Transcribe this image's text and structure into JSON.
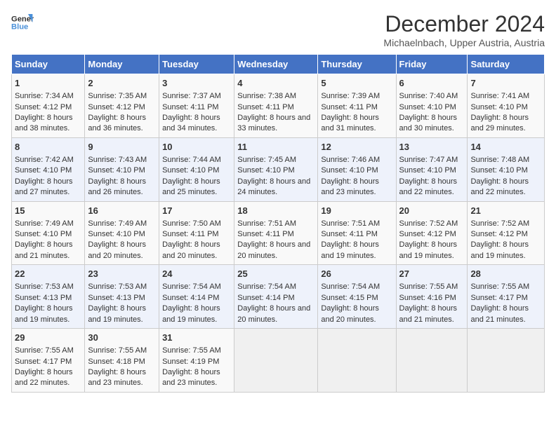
{
  "logo": {
    "line1": "General",
    "line2": "Blue"
  },
  "title": "December 2024",
  "subtitle": "Michaelnbach, Upper Austria, Austria",
  "days_of_week": [
    "Sunday",
    "Monday",
    "Tuesday",
    "Wednesday",
    "Thursday",
    "Friday",
    "Saturday"
  ],
  "weeks": [
    [
      {
        "day": "1",
        "sunrise": "7:34 AM",
        "sunset": "4:12 PM",
        "daylight": "8 hours and 38 minutes."
      },
      {
        "day": "2",
        "sunrise": "7:35 AM",
        "sunset": "4:12 PM",
        "daylight": "8 hours and 36 minutes."
      },
      {
        "day": "3",
        "sunrise": "7:37 AM",
        "sunset": "4:11 PM",
        "daylight": "8 hours and 34 minutes."
      },
      {
        "day": "4",
        "sunrise": "7:38 AM",
        "sunset": "4:11 PM",
        "daylight": "8 hours and 33 minutes."
      },
      {
        "day": "5",
        "sunrise": "7:39 AM",
        "sunset": "4:11 PM",
        "daylight": "8 hours and 31 minutes."
      },
      {
        "day": "6",
        "sunrise": "7:40 AM",
        "sunset": "4:10 PM",
        "daylight": "8 hours and 30 minutes."
      },
      {
        "day": "7",
        "sunrise": "7:41 AM",
        "sunset": "4:10 PM",
        "daylight": "8 hours and 29 minutes."
      }
    ],
    [
      {
        "day": "8",
        "sunrise": "7:42 AM",
        "sunset": "4:10 PM",
        "daylight": "8 hours and 27 minutes."
      },
      {
        "day": "9",
        "sunrise": "7:43 AM",
        "sunset": "4:10 PM",
        "daylight": "8 hours and 26 minutes."
      },
      {
        "day": "10",
        "sunrise": "7:44 AM",
        "sunset": "4:10 PM",
        "daylight": "8 hours and 25 minutes."
      },
      {
        "day": "11",
        "sunrise": "7:45 AM",
        "sunset": "4:10 PM",
        "daylight": "8 hours and 24 minutes."
      },
      {
        "day": "12",
        "sunrise": "7:46 AM",
        "sunset": "4:10 PM",
        "daylight": "8 hours and 23 minutes."
      },
      {
        "day": "13",
        "sunrise": "7:47 AM",
        "sunset": "4:10 PM",
        "daylight": "8 hours and 22 minutes."
      },
      {
        "day": "14",
        "sunrise": "7:48 AM",
        "sunset": "4:10 PM",
        "daylight": "8 hours and 22 minutes."
      }
    ],
    [
      {
        "day": "15",
        "sunrise": "7:49 AM",
        "sunset": "4:10 PM",
        "daylight": "8 hours and 21 minutes."
      },
      {
        "day": "16",
        "sunrise": "7:49 AM",
        "sunset": "4:10 PM",
        "daylight": "8 hours and 20 minutes."
      },
      {
        "day": "17",
        "sunrise": "7:50 AM",
        "sunset": "4:11 PM",
        "daylight": "8 hours and 20 minutes."
      },
      {
        "day": "18",
        "sunrise": "7:51 AM",
        "sunset": "4:11 PM",
        "daylight": "8 hours and 20 minutes."
      },
      {
        "day": "19",
        "sunrise": "7:51 AM",
        "sunset": "4:11 PM",
        "daylight": "8 hours and 19 minutes."
      },
      {
        "day": "20",
        "sunrise": "7:52 AM",
        "sunset": "4:12 PM",
        "daylight": "8 hours and 19 minutes."
      },
      {
        "day": "21",
        "sunrise": "7:52 AM",
        "sunset": "4:12 PM",
        "daylight": "8 hours and 19 minutes."
      }
    ],
    [
      {
        "day": "22",
        "sunrise": "7:53 AM",
        "sunset": "4:13 PM",
        "daylight": "8 hours and 19 minutes."
      },
      {
        "day": "23",
        "sunrise": "7:53 AM",
        "sunset": "4:13 PM",
        "daylight": "8 hours and 19 minutes."
      },
      {
        "day": "24",
        "sunrise": "7:54 AM",
        "sunset": "4:14 PM",
        "daylight": "8 hours and 19 minutes."
      },
      {
        "day": "25",
        "sunrise": "7:54 AM",
        "sunset": "4:14 PM",
        "daylight": "8 hours and 20 minutes."
      },
      {
        "day": "26",
        "sunrise": "7:54 AM",
        "sunset": "4:15 PM",
        "daylight": "8 hours and 20 minutes."
      },
      {
        "day": "27",
        "sunrise": "7:55 AM",
        "sunset": "4:16 PM",
        "daylight": "8 hours and 21 minutes."
      },
      {
        "day": "28",
        "sunrise": "7:55 AM",
        "sunset": "4:17 PM",
        "daylight": "8 hours and 21 minutes."
      }
    ],
    [
      {
        "day": "29",
        "sunrise": "7:55 AM",
        "sunset": "4:17 PM",
        "daylight": "8 hours and 22 minutes."
      },
      {
        "day": "30",
        "sunrise": "7:55 AM",
        "sunset": "4:18 PM",
        "daylight": "8 hours and 23 minutes."
      },
      {
        "day": "31",
        "sunrise": "7:55 AM",
        "sunset": "4:19 PM",
        "daylight": "8 hours and 23 minutes."
      },
      null,
      null,
      null,
      null
    ]
  ]
}
